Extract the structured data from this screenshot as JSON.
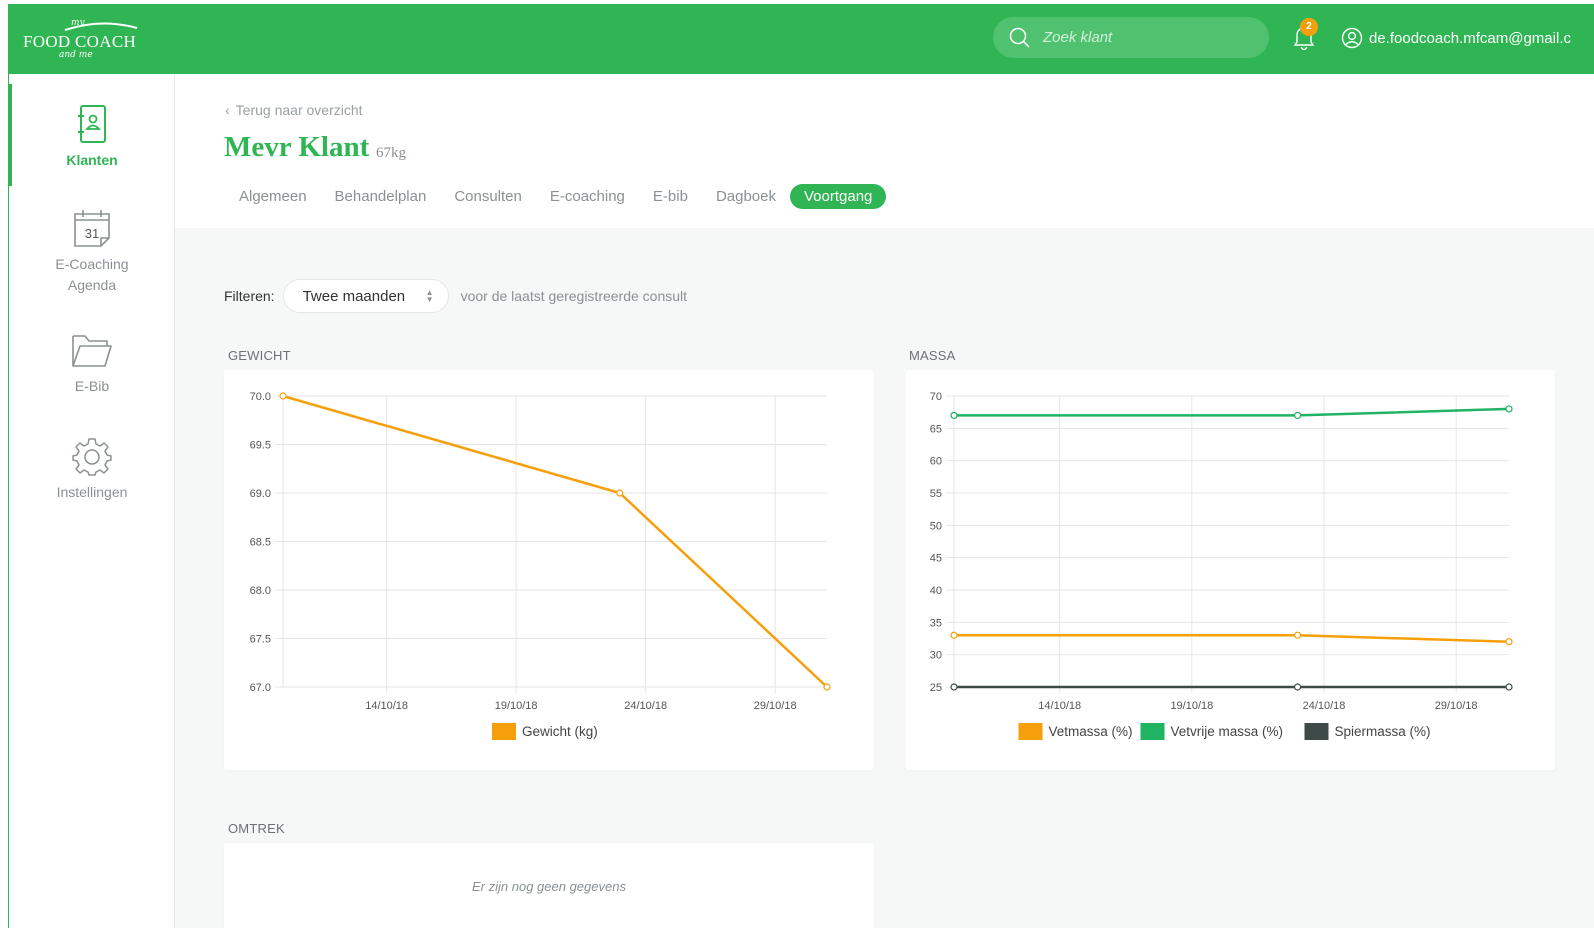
{
  "header": {
    "logo": {
      "my": "my",
      "brand": "FOOD COACH",
      "andme": "and me"
    },
    "search_placeholder": "Zoek klant",
    "notifications_count": "2",
    "user_email": "de.foodcoach.mfcam@gmail.c"
  },
  "sidebar": {
    "items": [
      {
        "label": "Klanten",
        "icon": "client-book-icon",
        "active": true
      },
      {
        "label": "E-Coaching",
        "label2": "Agenda",
        "icon": "calendar-icon",
        "day": "31"
      },
      {
        "label": "E-Bib",
        "icon": "folder-icon"
      },
      {
        "label": "Instellingen",
        "icon": "gear-icon"
      }
    ]
  },
  "page": {
    "back_label": "Terug naar overzicht",
    "client_name": "Mevr Klant",
    "client_weight": "67kg",
    "tabs": [
      "Algemeen",
      "Behandelplan",
      "Consulten",
      "E-coaching",
      "E-bib",
      "Dagboek",
      "Voortgang"
    ],
    "active_tab": "Voortgang",
    "filter": {
      "label": "Filteren:",
      "value": "Twee maanden",
      "hint": "voor de laatst geregistreerde consult"
    },
    "sections": {
      "gewicht": "GEWICHT",
      "massa": "MASSA",
      "omtrek": "OMTREK",
      "omtrek_empty": "Er zijn nog geen gegevens"
    }
  },
  "colors": {
    "brand_green": "#2fb553",
    "orange": "#f5a00a",
    "green_series": "#20b362",
    "dark_series": "#3e4a48"
  },
  "chart_data": [
    {
      "type": "line",
      "title": "",
      "x_ticks": [
        "14/10/18",
        "19/10/18",
        "24/10/18",
        "29/10/18"
      ],
      "y_ticks": [
        "70.0",
        "69.5",
        "69.0",
        "68.5",
        "68.0",
        "67.5",
        "67.0"
      ],
      "ylim": [
        67.0,
        70.0
      ],
      "xlim": [
        "2018-10-10",
        "2018-10-31"
      ],
      "grid": true,
      "legend_position": "bottom",
      "series": [
        {
          "name": "Gewicht (kg)",
          "color": "#f5a00a",
          "points": [
            {
              "x": "2018-10-10",
              "y": 70.0
            },
            {
              "x": "2018-10-23",
              "y": 69.0
            },
            {
              "x": "2018-10-31",
              "y": 67.0
            }
          ]
        }
      ]
    },
    {
      "type": "line",
      "title": "",
      "x_ticks": [
        "14/10/18",
        "19/10/18",
        "24/10/18",
        "29/10/18"
      ],
      "y_ticks": [
        "70",
        "65",
        "60",
        "55",
        "50",
        "45",
        "40",
        "35",
        "30",
        "25"
      ],
      "ylim": [
        25,
        70
      ],
      "xlim": [
        "2018-10-10",
        "2018-10-31"
      ],
      "grid": true,
      "legend_position": "bottom",
      "series": [
        {
          "name": "Vetmassa (%)",
          "color": "#f5a00a",
          "points": [
            {
              "x": "2018-10-10",
              "y": 33
            },
            {
              "x": "2018-10-23",
              "y": 33
            },
            {
              "x": "2018-10-31",
              "y": 32
            }
          ]
        },
        {
          "name": "Vetvrije massa (%)",
          "color": "#20b362",
          "points": [
            {
              "x": "2018-10-10",
              "y": 67
            },
            {
              "x": "2018-10-23",
              "y": 67
            },
            {
              "x": "2018-10-31",
              "y": 68
            }
          ]
        },
        {
          "name": "Spiermassa (%)",
          "color": "#3e4a48",
          "points": [
            {
              "x": "2018-10-10",
              "y": 25
            },
            {
              "x": "2018-10-23",
              "y": 25
            },
            {
              "x": "2018-10-31",
              "y": 25
            }
          ]
        }
      ]
    }
  ]
}
